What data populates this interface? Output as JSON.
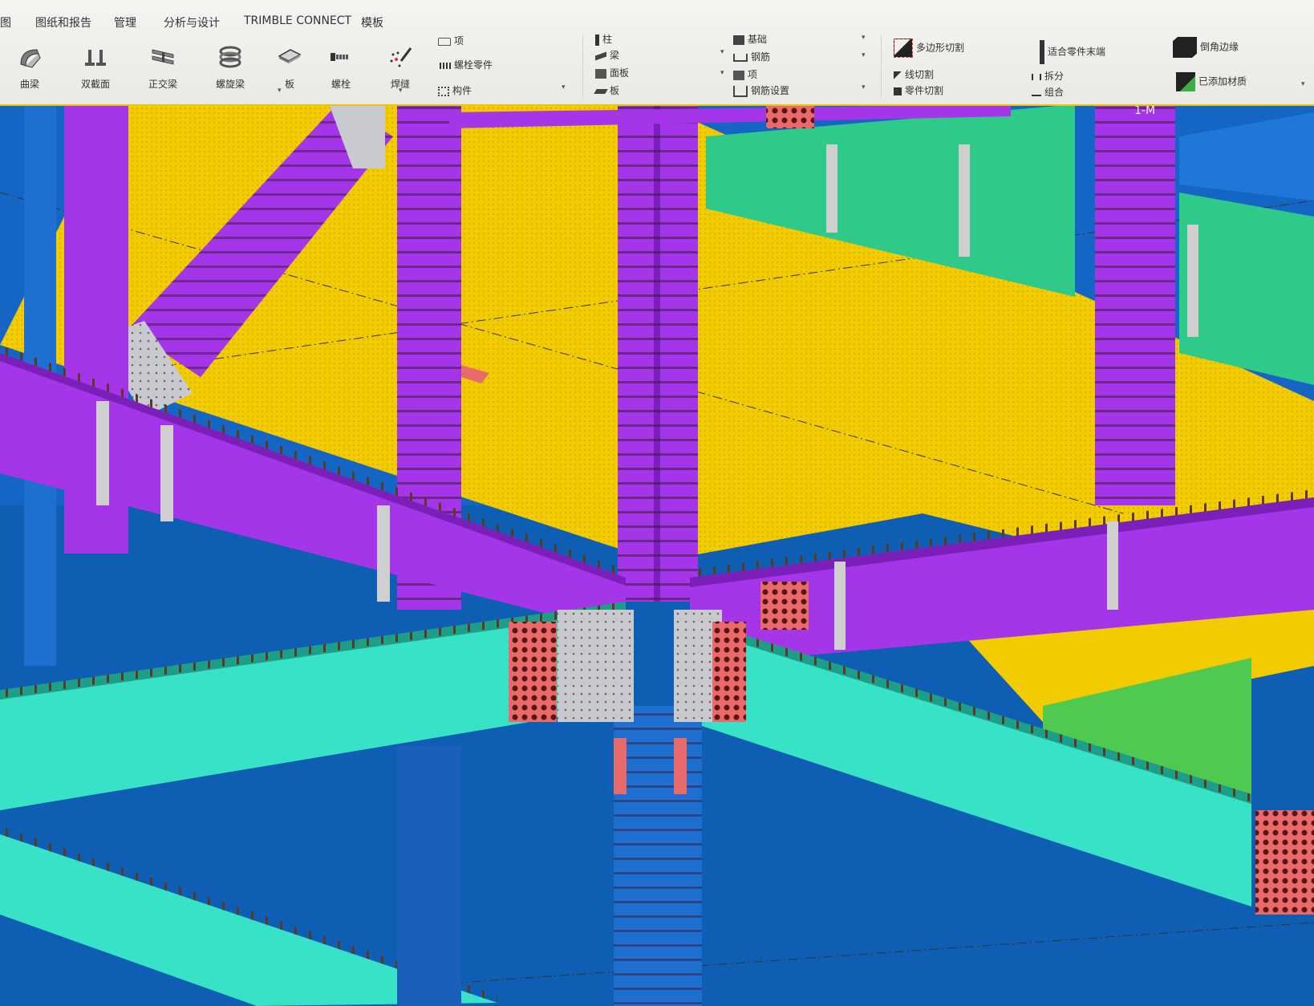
{
  "menu": {
    "tabs": [
      "图",
      "图纸和报告",
      "管理",
      "分析与设计",
      "TRIMBLE CONNECT",
      "模板"
    ]
  },
  "ribbon": {
    "large_tools": [
      {
        "label": "曲梁",
        "icon": "curved-beam-icon"
      },
      {
        "label": "双截面",
        "icon": "twin-profile-icon"
      },
      {
        "label": "正交梁",
        "icon": "orthogonal-beam-icon"
      },
      {
        "label": "螺旋梁",
        "icon": "spiral-beam-icon"
      },
      {
        "label": "板",
        "icon": "plate-icon"
      },
      {
        "label": "螺栓",
        "icon": "bolt-icon"
      },
      {
        "label": "焊缝",
        "icon": "weld-icon"
      }
    ],
    "group_bolt": [
      "项",
      "螺栓零件",
      "构件"
    ],
    "group_concrete": [
      "柱",
      "梁",
      "面板",
      "板"
    ],
    "group_rebar": [
      "基础",
      "钢筋",
      "项",
      "钢筋设置"
    ],
    "group_cut": [
      "多边形切割",
      "线切割",
      "零件切割"
    ],
    "group_fit": [
      "适合零件末端",
      "拆分",
      "组合"
    ],
    "group_edge": [
      "倒角边缘",
      "已添加材质"
    ]
  },
  "view": {
    "gridline_label": "1-M"
  },
  "colors": {
    "ribbon_bg": "#eeeeec",
    "accent_line": "#f0c400",
    "floor_yellow": "#f2cc00",
    "beam_purple": "#a435e8",
    "beam_teal": "#38e2c6",
    "background_blue": "#0e5fb3",
    "plate_red": "#e86a6a",
    "beam_green": "#2fc98a"
  }
}
